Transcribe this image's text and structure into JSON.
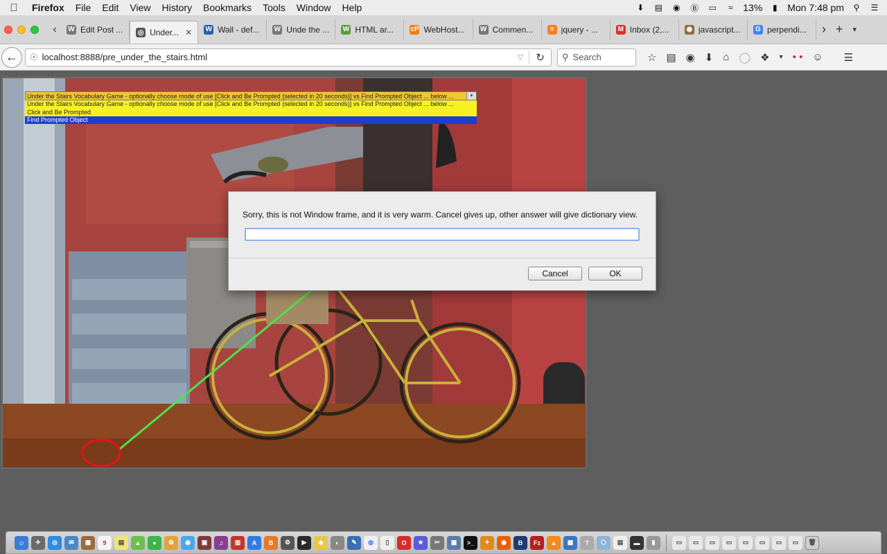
{
  "menubar": {
    "items": [
      "Firefox",
      "File",
      "Edit",
      "View",
      "History",
      "Bookmarks",
      "Tools",
      "Window",
      "Help"
    ],
    "battery": "13%",
    "clock": "Mon 7:48 pm"
  },
  "tabs": [
    {
      "label": "Edit Post ...",
      "icon": "wordpress-icon",
      "color": "#777777",
      "glyph": "W"
    },
    {
      "label": "Under...",
      "icon": "globe-icon",
      "color": "#555555",
      "glyph": "◎",
      "active": true
    },
    {
      "label": "Wall - def...",
      "icon": "dictionary-icon",
      "color": "#2b5fa8",
      "glyph": "W"
    },
    {
      "label": "Unde the ...",
      "icon": "wordpress-icon",
      "color": "#777777",
      "glyph": "W"
    },
    {
      "label": "HTML ar...",
      "icon": "w3-icon",
      "color": "#5a9a3b",
      "glyph": "W"
    },
    {
      "label": "WebHost...",
      "icon": "cpanel-icon",
      "color": "#f07d1a",
      "glyph": "cP"
    },
    {
      "label": "Commen...",
      "icon": "wordpress-icon",
      "color": "#777777",
      "glyph": "W"
    },
    {
      "label": "jquery - ...",
      "icon": "stackoverflow-icon",
      "color": "#f48024",
      "glyph": "≡"
    },
    {
      "label": "Inbox (2,...",
      "icon": "gmail-icon",
      "color": "#d93025",
      "glyph": "M"
    },
    {
      "label": "javascript...",
      "icon": "tab-site-icon",
      "color": "#8a6f3a",
      "glyph": "◉"
    },
    {
      "label": "perpendi...",
      "icon": "google-icon",
      "color": "#4285f4",
      "glyph": "G"
    }
  ],
  "navbar": {
    "url": "localhost:8888/pre_under_the_stairs.html",
    "search_placeholder": "Search"
  },
  "game": {
    "mode_select": {
      "current": "Under the Stairs Vocabulary Game - optionally choose mode of use [Click and Be Prompted (selected in 20 seconds)] vs Find Prompted Object ... below ...",
      "options": [
        "Under the Stairs Vocabulary Game - optionally choose mode of use [Click and Be Prompted (selected in 20 seconds)] vs Find Prompted Object ... below ...",
        "Click and Be Prompted",
        "Find Prompted Object"
      ],
      "highlighted": "Find Prompted Object"
    }
  },
  "dialog": {
    "message": "Sorry, this is not Window frame, and it is very warm.  Cancel gives up, other answer will give dictionary view.",
    "input_value": "",
    "cancel_label": "Cancel",
    "ok_label": "OK"
  },
  "colors": {
    "arrow": "#4ee34a",
    "circle": "#e8121b",
    "dialog_bg": "#ececec"
  }
}
